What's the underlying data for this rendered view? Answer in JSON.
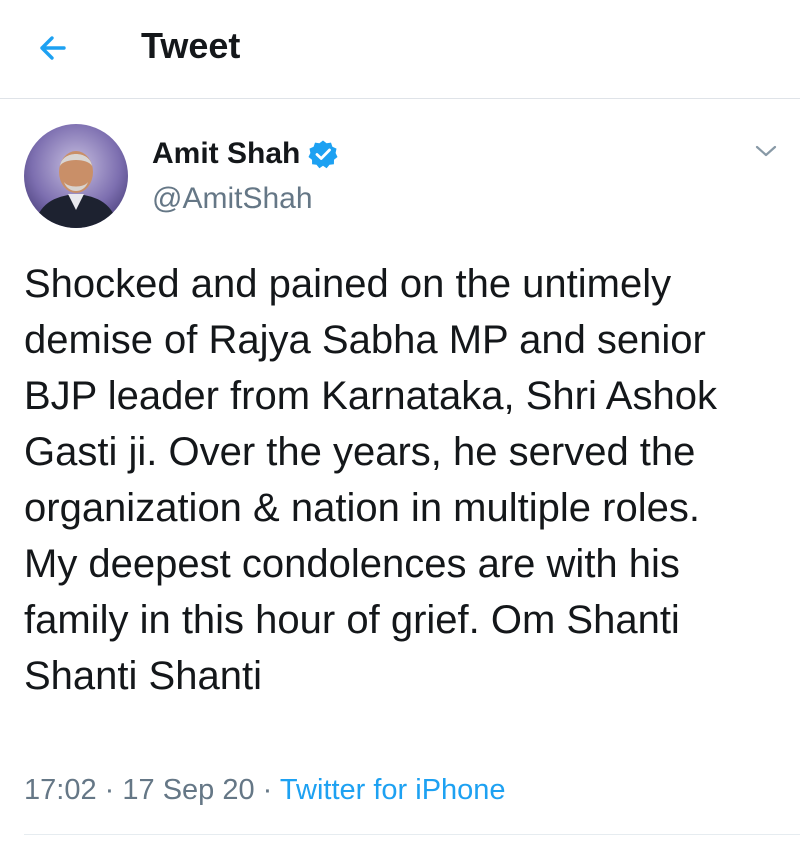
{
  "header": {
    "title": "Tweet",
    "back_icon": "arrow-left-icon"
  },
  "tweet": {
    "display_name": "Amit Shah",
    "handle": "@AmitShah",
    "verified": true,
    "text": "Shocked and pained on the untimely demise of Rajya Sabha MP and senior BJP leader from Karnataka, Shri Ashok Gasti ji. Over the years, he served the organization & nation in multiple roles. My deepest condolences are with his family in this hour of grief. Om Shanti Shanti Shanti",
    "time": "17:02",
    "separator": "·",
    "date": "17 Sep 20",
    "source": "Twitter for iPhone"
  },
  "colors": {
    "accent": "#1da1f2",
    "text_primary": "#14171a",
    "text_secondary": "#657786"
  }
}
